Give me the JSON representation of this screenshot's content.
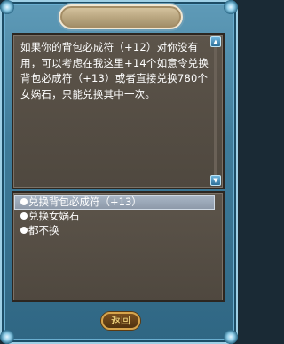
{
  "dialog": {
    "text": "如果你的背包必成符（+12）对你没有用，可以考虑在我这里+14个如意令兑换背包必成符（+13）或者直接兑换780个女娲石，只能兑换其中一次。"
  },
  "options": [
    {
      "label": "兑换背包必成符（+13）",
      "selected": true
    },
    {
      "label": "兑换女娲石",
      "selected": false
    },
    {
      "label": "都不换",
      "selected": false
    }
  ],
  "scrollbar": {
    "up_icon": "▲",
    "down_icon": "▼"
  },
  "footer": {
    "back_label": "返回"
  },
  "colors": {
    "frame": "#3f7c9a",
    "panel": "#57504a",
    "text": "#ffffff",
    "selection": "#9ba8b8",
    "button_text": "#ffe58a"
  }
}
